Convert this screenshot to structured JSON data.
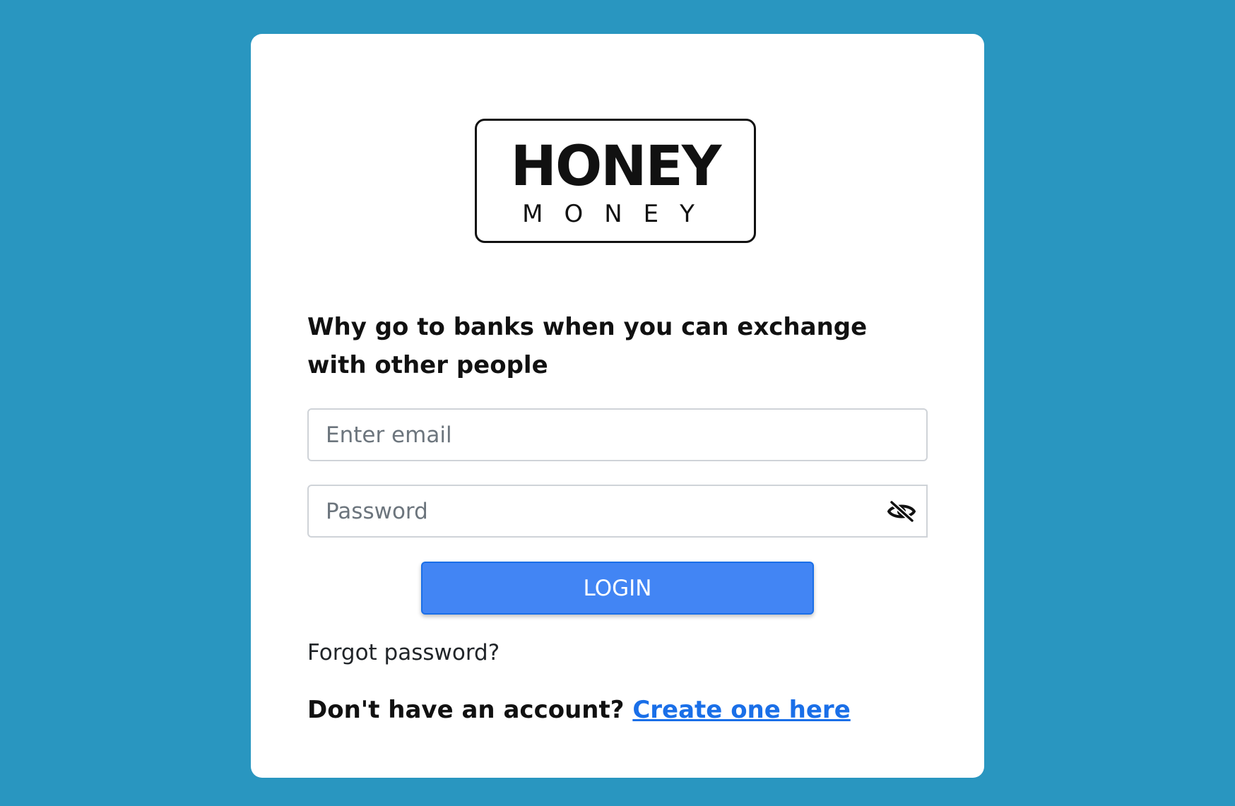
{
  "logo": {
    "main": "HONEY",
    "sub": "MONEY"
  },
  "tagline": "Why go to banks when you can exchange with other people",
  "email": {
    "placeholder": "Enter email",
    "value": ""
  },
  "password": {
    "placeholder": "Password",
    "value": "",
    "toggle_icon": "eye-slash-icon"
  },
  "login_button": "LOGIN",
  "forgot_password": "Forgot password?",
  "signup": {
    "prompt": "Don't have an account?",
    "link": "Create one here"
  },
  "colors": {
    "background": "#2996c0",
    "card": "#ffffff",
    "button": "#4285f4",
    "link": "#1a6fe8"
  }
}
